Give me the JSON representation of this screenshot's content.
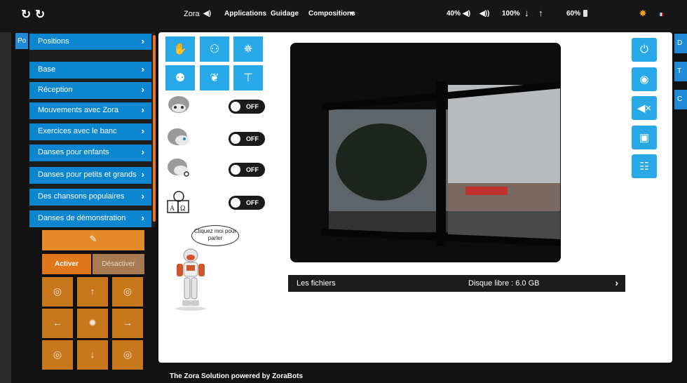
{
  "topbar": {
    "app_name": "Zora",
    "applications": "Applications",
    "guidage": "Guidage",
    "compositions": "Compositions",
    "volume": "40%",
    "speed": "100%",
    "battery": "60%"
  },
  "left_tab": {
    "label": "Po"
  },
  "menu": {
    "items": [
      "Positions",
      "Base",
      "Réception",
      "Mouvements avec Zora",
      "Exercices avec le banc",
      "Danses pour enfants",
      "Danses pour petits et grands",
      "Des chansons populaires",
      "Danses de démonstration"
    ]
  },
  "pad": {
    "activer": "Activer",
    "desactiver": "Désactiver"
  },
  "toggles": [
    "OFF",
    "OFF",
    "OFF",
    "OFF"
  ],
  "bubble": {
    "text": "Cliquez moi pour parler"
  },
  "files": {
    "label": "Les fichiers",
    "disk": "Disque libre : 6.0 GB"
  },
  "right_tabs": [
    "D",
    "T",
    "C"
  ],
  "footer": {
    "text": "The Zora Solution powered by ZoraBots"
  },
  "colors": {
    "menu_blue": "#0d86d1",
    "icon_blue": "#29a8e8",
    "pad_orange": "#e58a28",
    "topbar": "#161616"
  }
}
